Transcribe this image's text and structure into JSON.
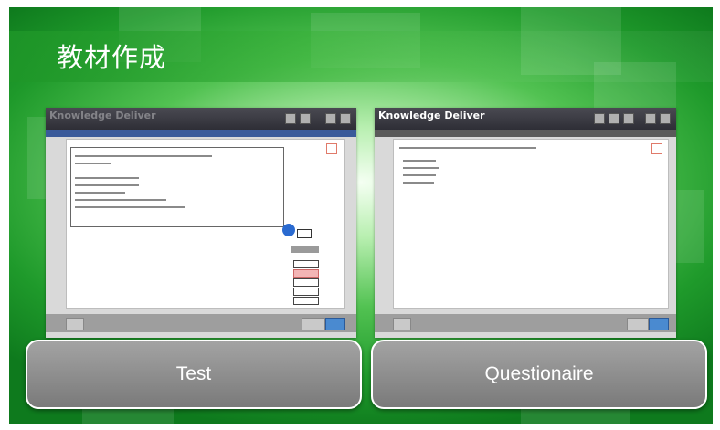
{
  "slide": {
    "title": "教材作成"
  },
  "left_screenshot": {
    "app_name": "Knowledge Deliver"
  },
  "right_screenshot": {
    "app_name": "Knowledge Deliver"
  },
  "buttons": {
    "test_label": "Test",
    "questionnaire_label": "Questionaire"
  },
  "colors": {
    "background_green": "#1f9a2b",
    "button_gray": "#8c8c8c",
    "title_text": "#ffffff"
  }
}
